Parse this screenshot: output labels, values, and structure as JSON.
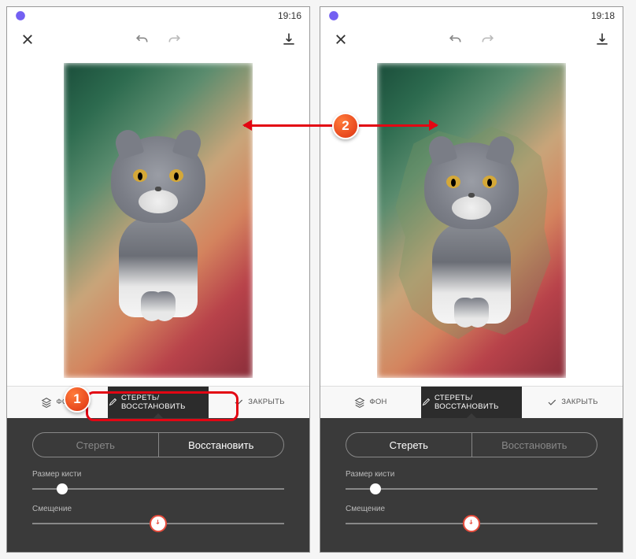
{
  "screen1": {
    "time": "19:16",
    "tabs": {
      "bg": "ФОН",
      "erase_restore": "СТЕРЕТЬ/ВОССТАНОВИТЬ",
      "close": "ЗАКРЫТЬ"
    },
    "toggle": {
      "erase": "Стереть",
      "restore": "Восстановить"
    },
    "sliders": {
      "brush_size": "Размер кисти",
      "offset": "Смещение"
    }
  },
  "screen2": {
    "time": "19:18",
    "tabs": {
      "bg": "ФОН",
      "erase_restore": "СТЕРЕТЬ/ВОССТАНОВИТЬ",
      "close": "ЗАКРЫТЬ"
    },
    "toggle": {
      "erase": "Стереть",
      "restore": "Восстановить"
    },
    "sliders": {
      "brush_size": "Размер кисти",
      "offset": "Смещение"
    }
  },
  "annotations": {
    "step1": "1",
    "step2": "2"
  }
}
